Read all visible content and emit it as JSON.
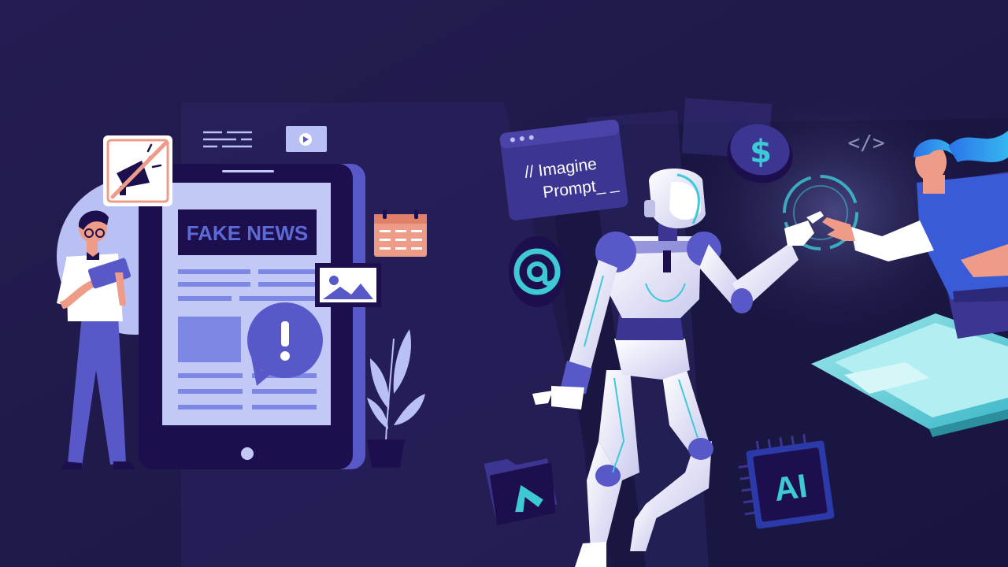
{
  "fake_news_headline": "FAKE NEWS",
  "prompt_card": {
    "line1": "// Imagine",
    "line2": "Prompt_ _"
  },
  "code_symbol": "</>",
  "chip_label": "AI",
  "icons": [
    "no-megaphone-icon",
    "text-lines-icon",
    "video-play-icon",
    "calendar-icon",
    "image-icon",
    "exclamation-bubble-icon",
    "at-sign-icon",
    "dollar-coin-icon",
    "code-tag-icon",
    "ai-chip-icon",
    "folder-icon",
    "plant-decor"
  ],
  "colors": {
    "background": "#231b4f",
    "background_right": "#1a1640",
    "accent_periwinkle": "#5858c8",
    "accent_light": "#b9c0f4",
    "accent_cyan": "#3ec9d6",
    "accent_salmon": "#ee9c88",
    "tablet_dark": "#1d0f4d"
  }
}
